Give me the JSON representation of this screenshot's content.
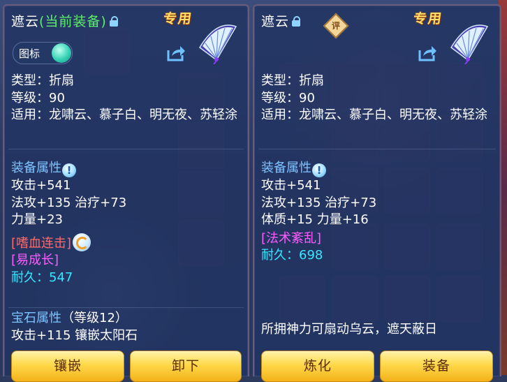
{
  "colors": {
    "panel_bg": "#223462",
    "section": "#7cc4ff",
    "current_tag": "#5df06a",
    "button": "#ffd84a",
    "durability": "#38e6ff"
  },
  "left": {
    "name": "遮云",
    "current": "(当前装备)",
    "tag": "专用",
    "toggle_label": "图标",
    "type": "类型：折扇",
    "level": "等级：90",
    "usable": "适用：龙啸云、慕子白、明无夜、苏轻涂",
    "attr_title": "装备属性",
    "attr_icon": "!",
    "attrs": [
      "攻击+541",
      "法攻+135 治疗+73",
      "力量+23"
    ],
    "skill": "[嗜血连击]",
    "skill2": "[易成长]",
    "durability": "耐久：547",
    "gem_title": "宝石属性",
    "gem_level": "（等级12）",
    "gem_attr": "攻击+115 镶嵌太阳石",
    "buttons": [
      "镶嵌",
      "卸下"
    ]
  },
  "right": {
    "name": "遮云",
    "ping": "评",
    "tag": "专用",
    "type": "类型：折扇",
    "level": "等级：90",
    "usable": "适用：龙啸云、慕子白、明无夜、苏轻涂",
    "attr_title": "装备属性",
    "attr_icon": "!",
    "attrs": [
      "攻击+541",
      "法攻+135 治疗+73",
      "体质+15 力量+16"
    ],
    "skill": "[法术紊乱]",
    "durability": "耐久：698",
    "desc": "所拥神力可扇动乌云，遮天蔽日",
    "buttons": [
      "炼化",
      "装备"
    ]
  }
}
